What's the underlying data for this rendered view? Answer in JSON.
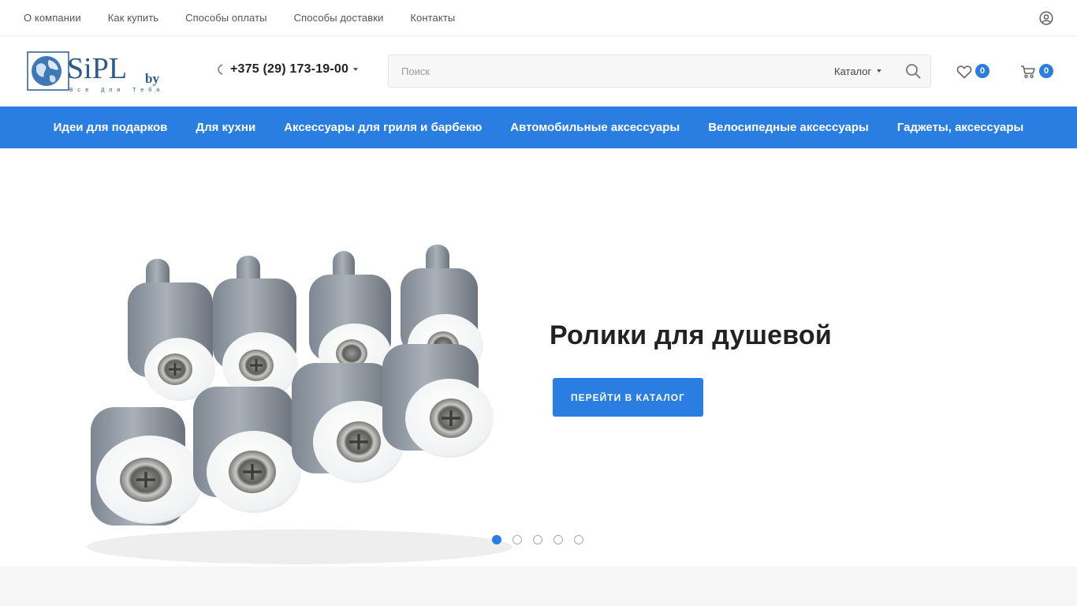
{
  "topbar": {
    "links": [
      "О компании",
      "Как купить",
      "Способы оплаты",
      "Способы доставки",
      "Контакты"
    ],
    "user_icon": "user-circle-icon"
  },
  "logo": {
    "main": "SiPL",
    "suffix": "by",
    "tagline": "Все Для Тебя"
  },
  "header": {
    "phone": "+375 (29) 173-19-00",
    "search_placeholder": "Поиск",
    "search_category": "Каталог",
    "favorites_count": "0",
    "cart_count": "0"
  },
  "nav": {
    "items": [
      "Идеи для подарков",
      "Для кухни",
      "Аксессуары для гриля и барбекю",
      "Автомобильные аксессуары",
      "Велосипедные аксессуары",
      "Гаджеты, аксессуары"
    ]
  },
  "hero": {
    "title": "Ролики для душевой",
    "cta_label": "ПЕРЕЙТИ В КАТАЛОГ",
    "slides_total": 5,
    "active_slide": 1
  },
  "colors": {
    "accent": "#2a7de1"
  }
}
